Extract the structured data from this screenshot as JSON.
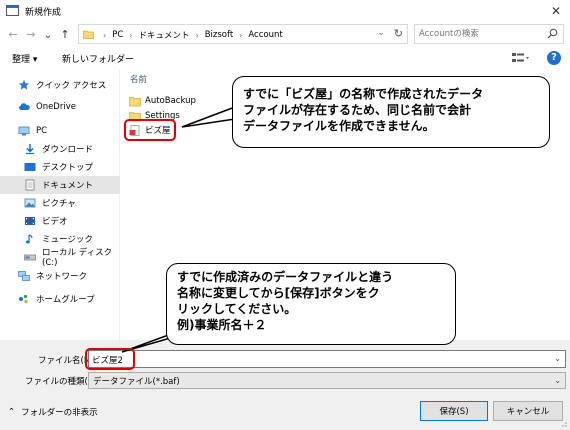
{
  "window": {
    "title": "新規作成",
    "close": "✕"
  },
  "nav": {
    "back": "←",
    "forward": "→",
    "recent": "⌄",
    "up": "↑"
  },
  "address": {
    "crumbs": [
      "PC",
      "ドキュメント",
      "Bizsoft",
      "Account"
    ],
    "separator": "›"
  },
  "search": {
    "placeholder": "Accountの検索"
  },
  "toolbar": {
    "organize": "整理 ▾",
    "new_folder": "新しいフォルダー",
    "help": "?"
  },
  "sidebar": {
    "items": [
      {
        "label": "クイック アクセス",
        "icon": "star-icon"
      },
      {
        "label": "OneDrive",
        "icon": "cloud-icon"
      },
      {
        "label": "PC",
        "icon": "computer-icon"
      },
      {
        "label": "ダウンロード",
        "icon": "download-icon"
      },
      {
        "label": "デスクトップ",
        "icon": "desktop-icon"
      },
      {
        "label": "ドキュメント",
        "icon": "documents-icon"
      },
      {
        "label": "ピクチャ",
        "icon": "pictures-icon"
      },
      {
        "label": "ビデオ",
        "icon": "video-icon"
      },
      {
        "label": "ミュージック",
        "icon": "music-icon"
      },
      {
        "label": "ローカル ディスク (C:)",
        "icon": "disk-icon"
      },
      {
        "label": "ネットワーク",
        "icon": "network-icon"
      },
      {
        "label": "ホームグループ",
        "icon": "homegroup-icon"
      }
    ],
    "selected": "ドキュメント"
  },
  "content": {
    "column_header": "名前",
    "files": [
      {
        "name": "AutoBackup",
        "type": "folder"
      },
      {
        "name": "Settings",
        "type": "folder"
      },
      {
        "name": "ビズ屋",
        "type": "data-file"
      }
    ]
  },
  "form": {
    "filename_label": "ファイル名(N):",
    "filename_value": "ビズ屋2",
    "filetype_label": "ファイルの種類(T):",
    "filetype_value": "データファイル(*.baf)",
    "hide_folders": "フォルダーの非表示",
    "save": "保存(S)",
    "cancel": "キャンセル"
  },
  "callouts": {
    "top": [
      "すでに「ビズ屋」の名称で作成されたデータ",
      "ファイルが存在するため、同じ名前で会計",
      "データファイルを作成できません。"
    ],
    "bottom": [
      "すでに作成済みのデータファイルと違う",
      "名称に変更してから[保存]ボタンをク",
      "リックしてください。",
      "例)事業所名＋２"
    ]
  },
  "colors": {
    "highlight": "#e10000",
    "accent": "#0078d7",
    "selected_bg": "#e5e5e5"
  }
}
